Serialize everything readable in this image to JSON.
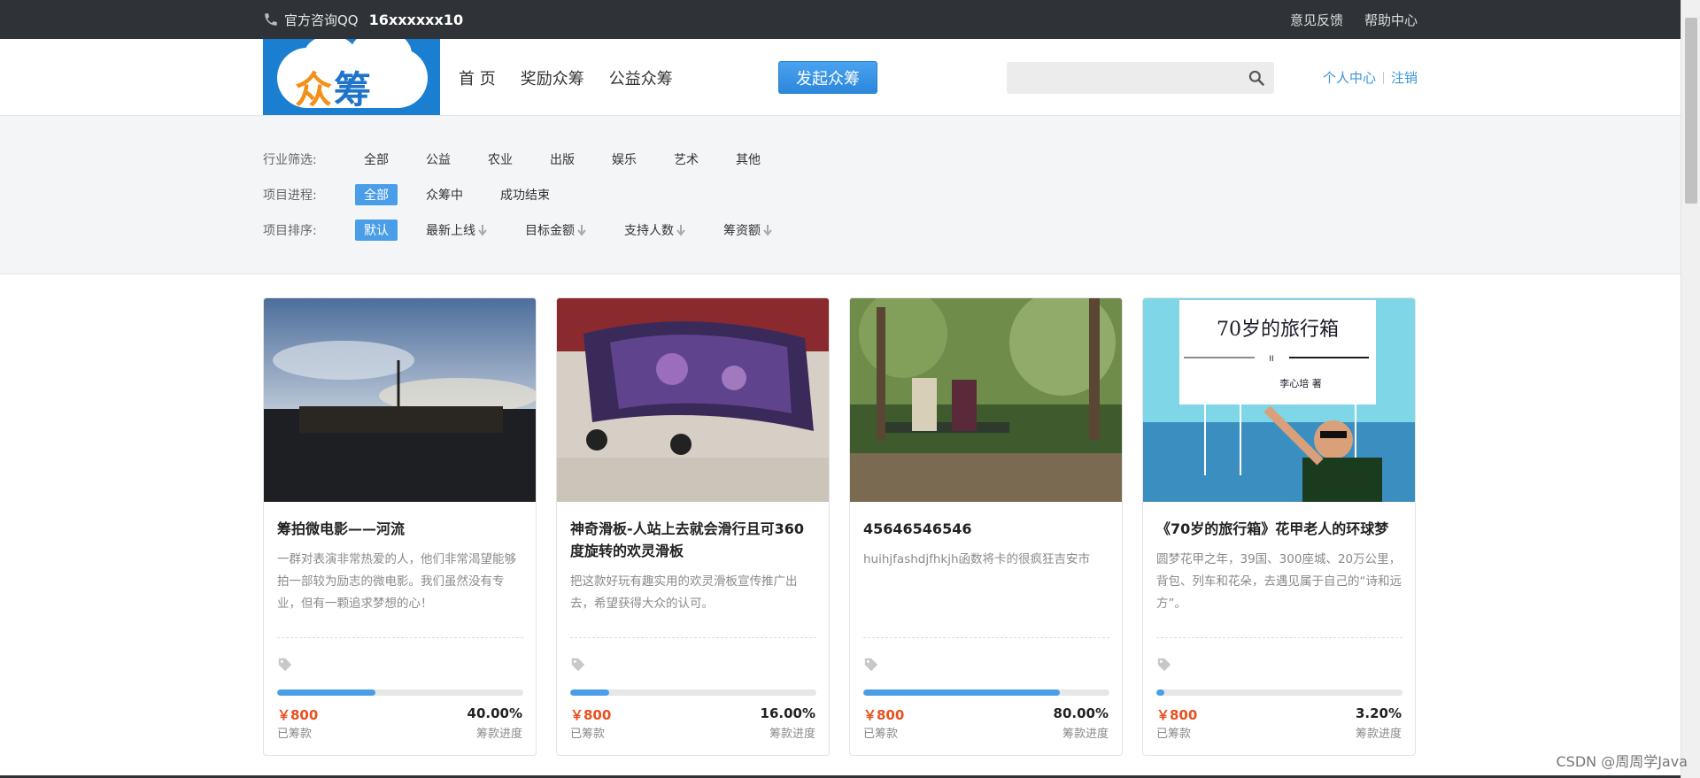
{
  "topbar": {
    "phone_icon": "phone-icon",
    "contact_label": "官方咨询QQ",
    "contact_qq": "16xxxxxx10",
    "links": [
      "意见反馈",
      "帮助中心"
    ]
  },
  "header": {
    "logo_text_1": "众",
    "logo_text_2": "筹",
    "nav": [
      "首 页",
      "奖励众筹",
      "公益众筹"
    ],
    "launch_button": "发起众筹",
    "search_placeholder": "",
    "search_icon": "search-icon",
    "user_links": [
      "个人中心",
      "注销"
    ]
  },
  "filters": {
    "industry": {
      "label": "行业筛选:",
      "options": [
        "全部",
        "公益",
        "农业",
        "出版",
        "娱乐",
        "艺术",
        "其他"
      ],
      "selected": null
    },
    "progress": {
      "label": "项目进程:",
      "options": [
        "全部",
        "众筹中",
        "成功结束"
      ],
      "selected": 0
    },
    "sort": {
      "label": "项目排序:",
      "options": [
        "默认",
        "最新上线",
        "目标金额",
        "支持人数",
        "筹资额"
      ],
      "selected": 0
    }
  },
  "projects": [
    {
      "title": "筹拍微电影——河流",
      "desc": "一群对表演非常热爱的人，他们非常渴望能够拍一部较为励志的微电影。我们虽然没有专业，但有一颗追求梦想的心！",
      "amount": "￥800",
      "amount_label": "已筹款",
      "progress_text": "40.00%",
      "progress_value": 40,
      "progress_label": "筹款进度"
    },
    {
      "title": "神奇滑板-人站上去就会滑行且可360度旋转的欢灵滑板",
      "desc": "把这款好玩有趣实用的欢灵滑板宣传推广出去，希望获得大众的认可。",
      "amount": "￥800",
      "amount_label": "已筹款",
      "progress_text": "16.00%",
      "progress_value": 16,
      "progress_label": "筹款进度"
    },
    {
      "title": "45646546546",
      "desc": "huihjfashdjfhkjh函数将卡的很疯狂吉安市",
      "amount": "￥800",
      "amount_label": "已筹款",
      "progress_text": "80.00%",
      "progress_value": 80,
      "progress_label": "筹款进度"
    },
    {
      "title": "《70岁的旅行箱》花甲老人的环球梦",
      "desc": "圆梦花甲之年，39国、300座城、20万公里，背包、列车和花朵，去遇见属于自己的“诗和远方”。",
      "amount": "￥800",
      "amount_label": "已筹款",
      "progress_text": "3.20%",
      "progress_value": 3.2,
      "progress_label": "筹款进度",
      "cover_title": "70岁的旅行箱",
      "cover_author": "李心培 著",
      "cover_mark": "II"
    }
  ],
  "watermark": "CSDN @周周学Java",
  "colors": {
    "accent": "#4a9ee7",
    "topbar": "#2f3237",
    "price": "#e8501f"
  }
}
